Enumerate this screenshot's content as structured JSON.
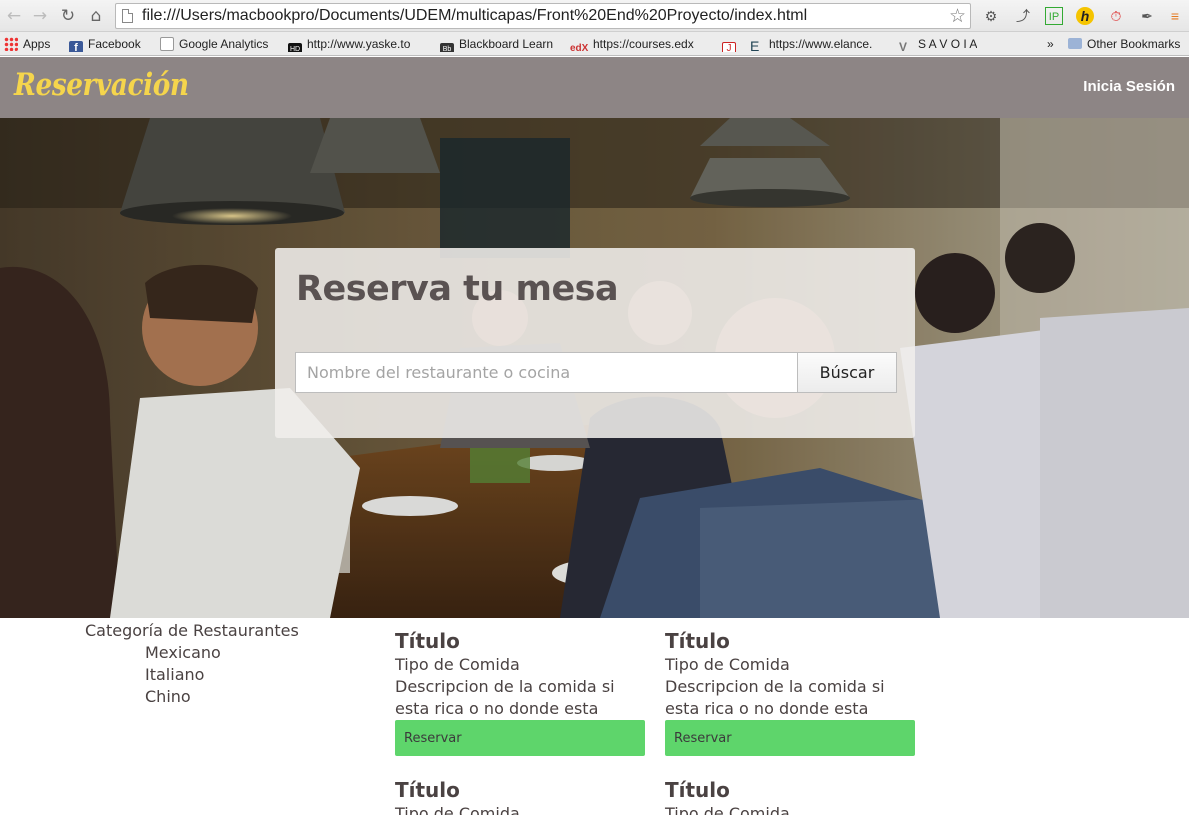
{
  "browser": {
    "url": "file:///Users/macbookpro/Documents/UDEM/multicapas/Front%20End%20Proyecto/index.html",
    "bookmarks": [
      {
        "label": "Apps",
        "icon": "apps-grid-icon"
      },
      {
        "label": "Facebook",
        "icon": "facebook-icon"
      },
      {
        "label": "Google Analytics",
        "icon": "page-icon"
      },
      {
        "label": "http://www.yaske.to",
        "icon": "hd-icon"
      },
      {
        "label": "Blackboard Learn",
        "icon": "blackboard-icon"
      },
      {
        "label": "https://courses.edx",
        "icon": "edx-icon"
      },
      {
        "label": "",
        "icon": "j-icon"
      },
      {
        "label": "https://www.elance.",
        "icon": "elance-icon"
      },
      {
        "label": "S A V O I A",
        "icon": "savoia-icon"
      }
    ],
    "overflow": "»",
    "other_bookmarks": "Other Bookmarks"
  },
  "header": {
    "brand": "Reservación",
    "login": "Inicia Sesión",
    "brand_color": "#f5d54c",
    "bar_color": "#8d8585"
  },
  "hero": {
    "title": "Reserva tu mesa",
    "search_placeholder": "Nombre del restaurante o cocina",
    "search_button": "Búscar"
  },
  "categories": {
    "heading": "Categoría de Restaurantes",
    "items": [
      "Mexicano",
      "Italiano",
      "Chino"
    ]
  },
  "cards": [
    {
      "title": "Título",
      "type": "Tipo de Comida",
      "desc": "Descripcion de la comida si esta rica o no donde esta",
      "button": "Reservar"
    },
    {
      "title": "Título",
      "type": "Tipo de Comida",
      "desc": "Descripcion de la comida si esta rica o no donde esta",
      "button": "Reservar"
    },
    {
      "title": "Título",
      "type": "Tipo de Comida"
    },
    {
      "title": "Título",
      "type": "Tipo de Comida"
    }
  ],
  "colors": {
    "reserve_button": "#5ed56b"
  }
}
